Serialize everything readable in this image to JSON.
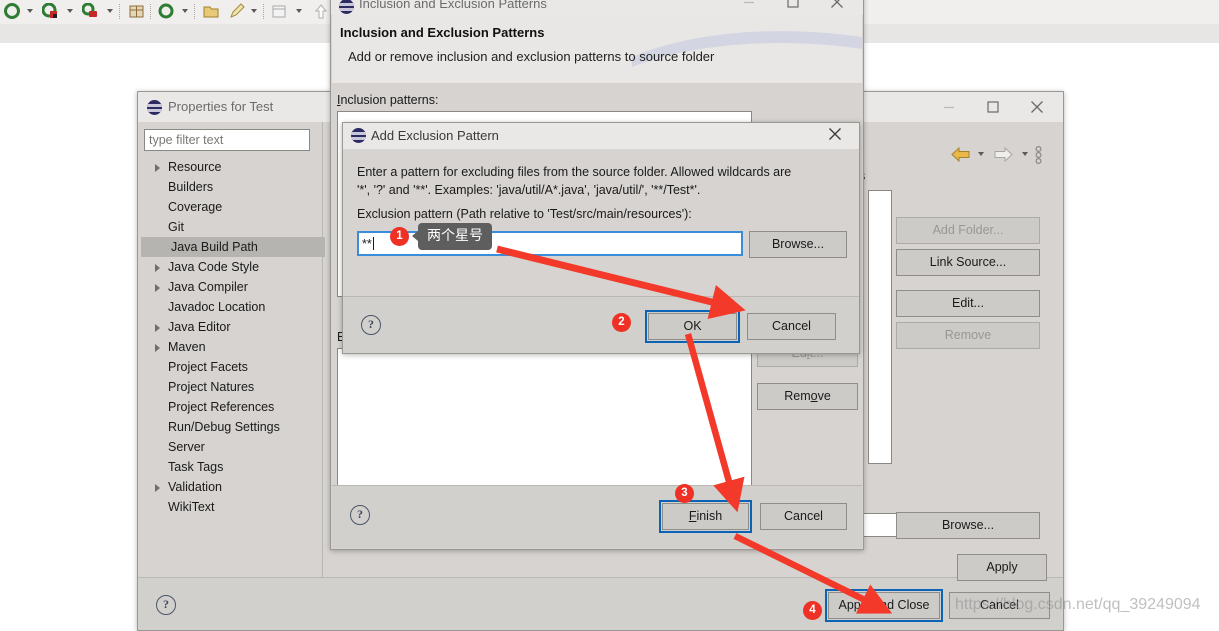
{
  "watermark": "https://blog.csdn.net/qq_39249094",
  "eclipse_toolbar": {
    "icons": [
      "debug-icon",
      "run-icon",
      "coverage-icon",
      "new-package-icon",
      "search-icon",
      "open-folder-icon",
      "pencil-icon",
      "table-icon",
      "arrow-up-icon"
    ]
  },
  "properties_dialog": {
    "title": "Properties for Test",
    "filter": {
      "placeholder": "type filter text",
      "value": ""
    },
    "tree": [
      {
        "label": "Resource",
        "expandable": true,
        "selected": false
      },
      {
        "label": "Builders",
        "expandable": false,
        "selected": false
      },
      {
        "label": "Coverage",
        "expandable": false,
        "selected": false
      },
      {
        "label": "Git",
        "expandable": false,
        "selected": false
      },
      {
        "label": "Java Build Path",
        "expandable": false,
        "selected": true
      },
      {
        "label": "Java Code Style",
        "expandable": true,
        "selected": false
      },
      {
        "label": "Java Compiler",
        "expandable": true,
        "selected": false
      },
      {
        "label": "Javadoc Location",
        "expandable": false,
        "selected": false
      },
      {
        "label": "Java Editor",
        "expandable": true,
        "selected": false
      },
      {
        "label": "Maven",
        "expandable": true,
        "selected": false
      },
      {
        "label": "Project Facets",
        "expandable": false,
        "selected": false
      },
      {
        "label": "Project Natures",
        "expandable": false,
        "selected": false
      },
      {
        "label": "Project References",
        "expandable": false,
        "selected": false
      },
      {
        "label": "Run/Debug Settings",
        "expandable": false,
        "selected": false
      },
      {
        "label": "Server",
        "expandable": false,
        "selected": false
      },
      {
        "label": "Task Tags",
        "expandable": false,
        "selected": false
      },
      {
        "label": "Validation",
        "expandable": true,
        "selected": false
      },
      {
        "label": "WikiText",
        "expandable": false,
        "selected": false
      }
    ],
    "partial_tab_text": "es",
    "side_buttons": {
      "add_folder": "Add Folder...",
      "link_source": "Link Source...",
      "edit": "Edit...",
      "remove": "Remove"
    },
    "browse": "Browse...",
    "apply": "Apply",
    "apply_and_close": "Apply and Close",
    "cancel": "Cancel",
    "help_glyph": "?",
    "nav": {
      "back": "back-arrow",
      "forward": "forward-arrow",
      "menu": "view-menu-dots"
    }
  },
  "wizard_dialog": {
    "title": "Inclusion and Exclusion Patterns",
    "heading": "Inclusion and Exclusion Patterns",
    "subheading": "Add or remove inclusion and exclusion patterns to source folder",
    "inclusion_label": "Inclusion patterns:",
    "exclusion_label_partial": "E",
    "buttons": {
      "edit": "Edit...",
      "remove": "Remove",
      "finish": "Finish",
      "cancel": "Cancel"
    },
    "help_glyph": "?"
  },
  "add_exclusion_dialog": {
    "title": "Add Exclusion Pattern",
    "description_line1": "Enter a pattern for excluding files from the source folder. Allowed wildcards are",
    "description_line2": "'*', '?' and '**'. Examples: 'java/util/A*.java', 'java/util/', '**/Test*'.",
    "field_label": "Exclusion pattern (Path relative to 'Test/src/main/resources'):",
    "field_value": "**",
    "browse": "Browse...",
    "ok": "OK",
    "cancel": "Cancel",
    "help_glyph": "?"
  },
  "annotations": {
    "badges": [
      "1",
      "2",
      "3",
      "4"
    ],
    "tooltip_text": "两个星号",
    "accent_color": "#ee3124",
    "highlight_color": "#0b63b5"
  }
}
